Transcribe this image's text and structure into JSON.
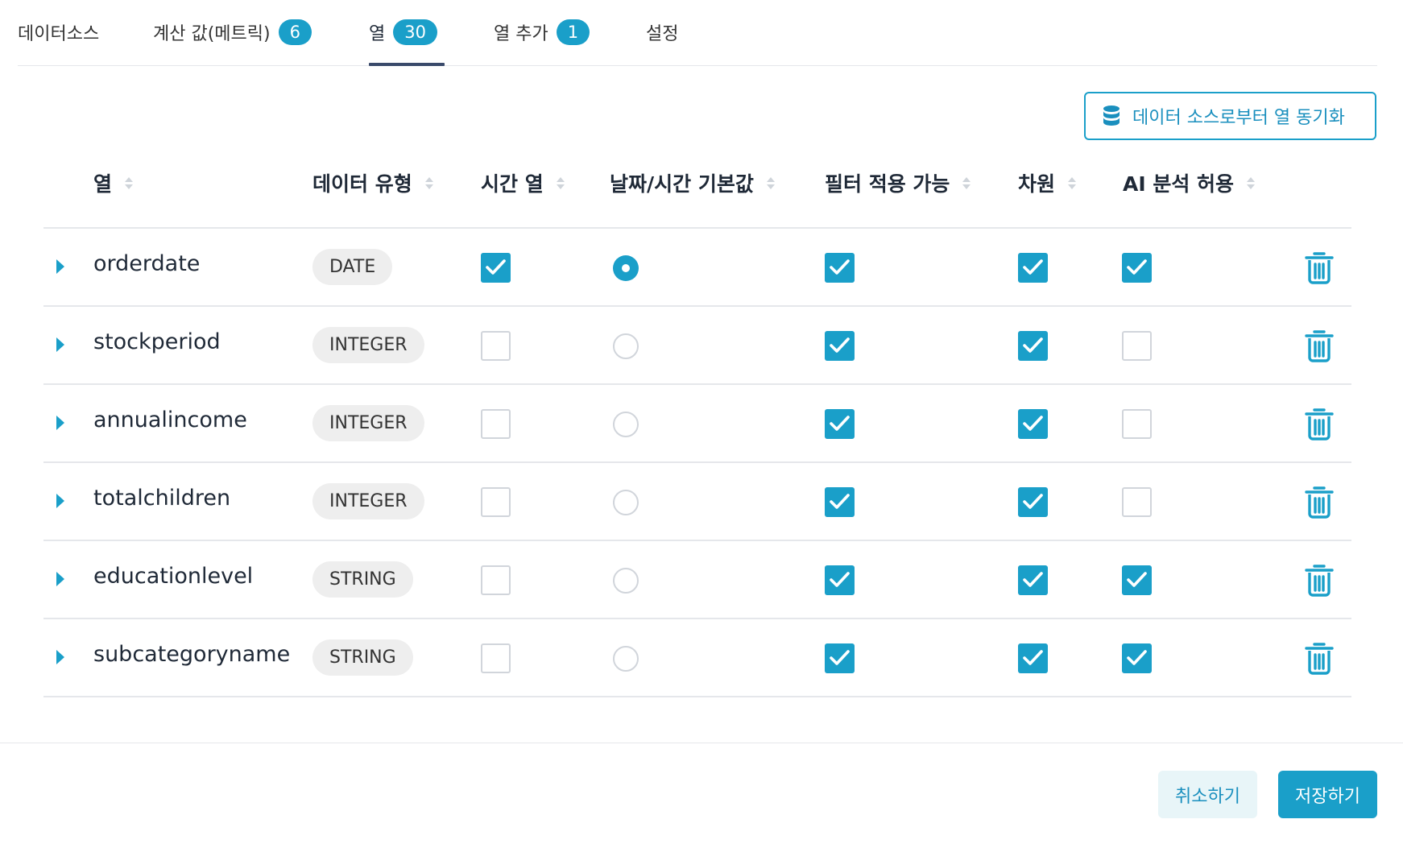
{
  "tabs": [
    {
      "label": "데이터소스",
      "badge": ""
    },
    {
      "label": "계산 값(메트릭)",
      "badge": "6"
    },
    {
      "label": "열",
      "badge": "30"
    },
    {
      "label": "열 추가",
      "badge": "1"
    },
    {
      "label": "설정",
      "badge": ""
    }
  ],
  "active_tab": "열",
  "sync_button": {
    "label": "데이터 소스로부터 열 동기화",
    "icon": "database-icon"
  },
  "table": {
    "headers": [
      "열",
      "데이터 유형",
      "시간 열",
      "날짜/시간 기본값",
      "필터 적용 가능",
      "차원",
      "AI 분석 허용"
    ],
    "rows": [
      {
        "name": "orderdate",
        "type": "DATE",
        "time_column": true,
        "default_datetime": true,
        "filterable": true,
        "dimension": true,
        "ai_allowed": true
      },
      {
        "name": "stockperiod",
        "type": "INTEGER",
        "time_column": false,
        "default_datetime": false,
        "filterable": true,
        "dimension": true,
        "ai_allowed": false
      },
      {
        "name": "annualincome",
        "type": "INTEGER",
        "time_column": false,
        "default_datetime": false,
        "filterable": true,
        "dimension": true,
        "ai_allowed": false
      },
      {
        "name": "totalchildren",
        "type": "INTEGER",
        "time_column": false,
        "default_datetime": false,
        "filterable": true,
        "dimension": true,
        "ai_allowed": false
      },
      {
        "name": "educationlevel",
        "type": "STRING",
        "time_column": false,
        "default_datetime": false,
        "filterable": true,
        "dimension": true,
        "ai_allowed": true
      },
      {
        "name": "subcategoryname",
        "type": "STRING",
        "time_column": false,
        "default_datetime": false,
        "filterable": true,
        "dimension": true,
        "ai_allowed": true
      }
    ]
  },
  "footer": {
    "cancel_label": "취소하기",
    "save_label": "저장하기"
  },
  "colors": {
    "accent": "#1a9fc9",
    "tab_underline": "#3a4a6b",
    "cancel_bg": "#e8f5f8"
  }
}
